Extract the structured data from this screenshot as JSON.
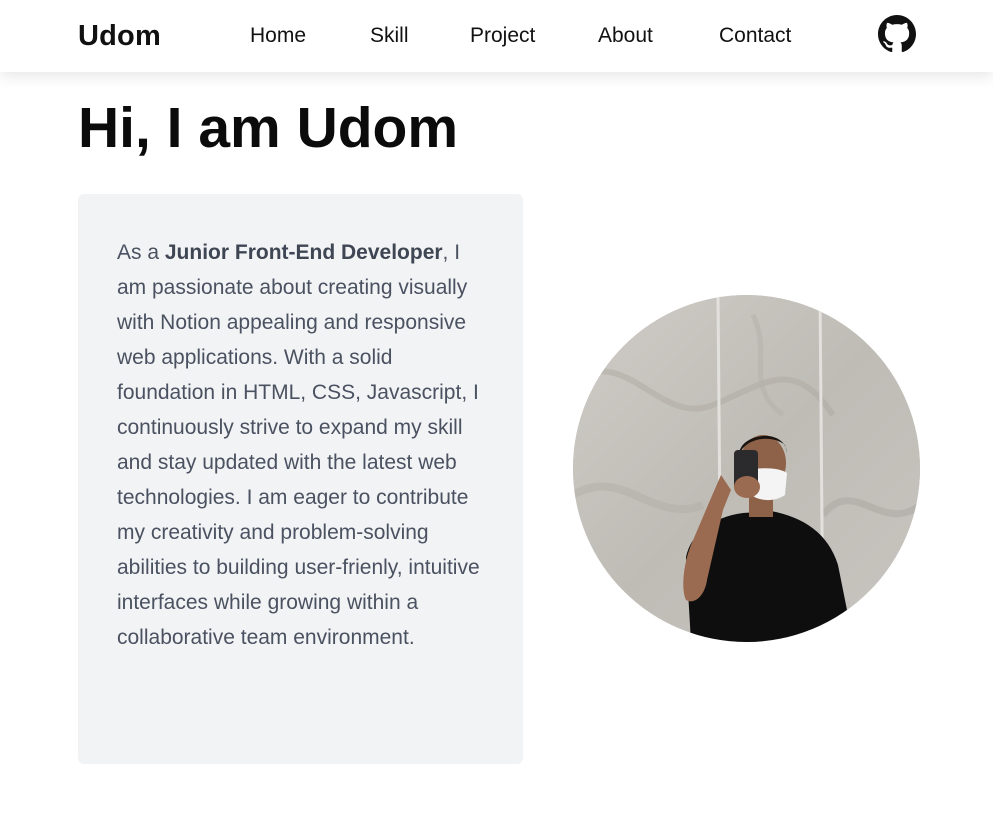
{
  "nav": {
    "brand": "Udom",
    "links": [
      {
        "label": "Home"
      },
      {
        "label": "Skill"
      },
      {
        "label": "Project"
      },
      {
        "label": "About"
      },
      {
        "label": "Contact"
      }
    ],
    "github_icon": "github-icon"
  },
  "hero": {
    "headline": "Hi, I am Udom",
    "bio": {
      "prefix": "As a ",
      "role": "Junior Front-End Developer",
      "body": ", I am passionate about creating visually with Notion appealing and responsive web applications. With a solid foundation in HTML, CSS, Javascript, I continuously strive to expand my skill and stay updated with the latest web technologies. I am eager to contribute my creativity and problem-solving abilities to building user-frienly, intuitive interfaces while growing within a collaborative team environment."
    },
    "avatar_icon": "profile-photo"
  },
  "colors": {
    "card_bg": "#f2f3f5",
    "bio_text": "#4a5160",
    "heading": "#0b0b0b"
  }
}
